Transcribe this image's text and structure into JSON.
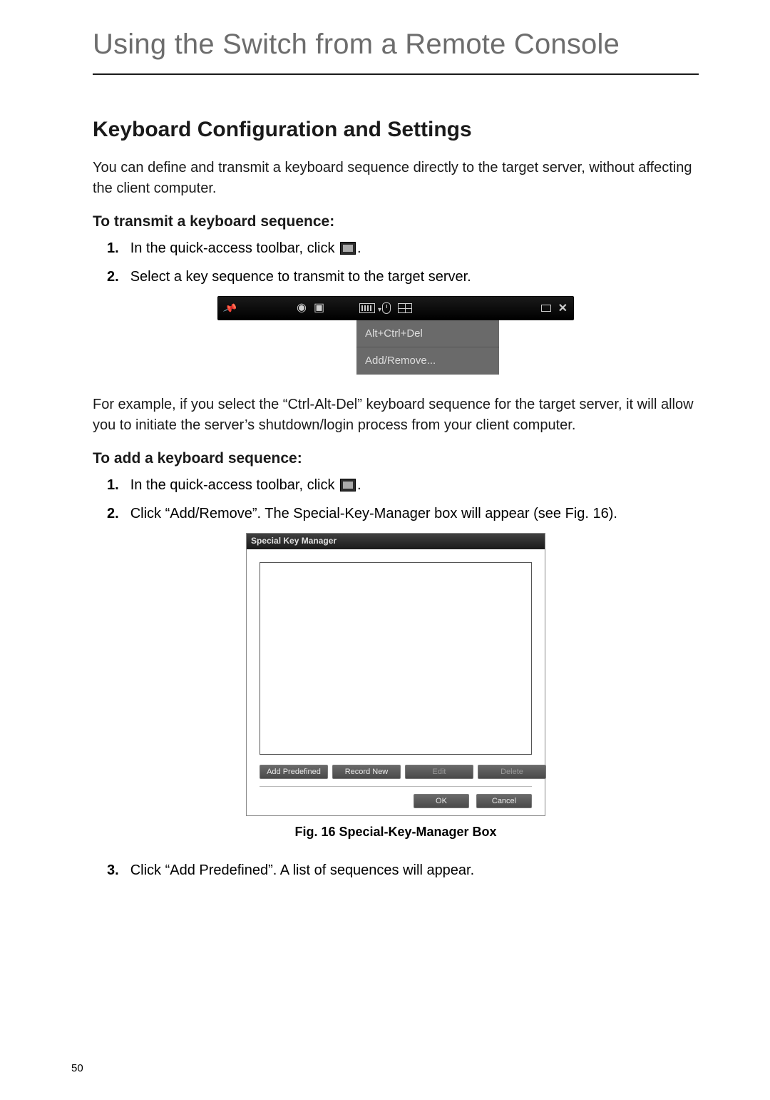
{
  "header": {
    "title": "Using the Switch from a Remote Console"
  },
  "section": {
    "title": "Keyboard Configuration and Settings"
  },
  "intro": "You can define and transmit a keyboard sequence directly to the target server, without affecting the client computer.",
  "transmit": {
    "title": "To transmit a keyboard sequence:",
    "step1_a": "In the quick-access toolbar, click ",
    "step1_b": ".",
    "step2": "Select a key sequence to transmit to the target server.",
    "dropdown": {
      "item1": "Alt+Ctrl+Del",
      "item2": "Add/Remove..."
    },
    "after": "For example, if you select the “Ctrl-Alt-Del” keyboard sequence for the target server, it will allow you to initiate the server’s shutdown/login process from your client computer."
  },
  "add": {
    "title": "To add a keyboard sequence:",
    "step1_a": "In the quick-access toolbar, click ",
    "step1_b": ".",
    "step2": "Click “Add/Remove”. The Special-Key-Manager box will appear (see Fig. 16).",
    "skm": {
      "title": "Special Key Manager",
      "btn_add": "Add Predefined",
      "btn_record": "Record New",
      "btn_edit": "Edit",
      "btn_delete": "Delete",
      "btn_ok": "OK",
      "btn_cancel": "Cancel"
    },
    "figcap": "Fig. 16 Special-Key-Manager Box",
    "step3": "Click “Add Predefined”. A list of sequences will appear."
  },
  "pagenum": "50",
  "nums": {
    "n1": "1.",
    "n2": "2.",
    "n3": "3."
  }
}
